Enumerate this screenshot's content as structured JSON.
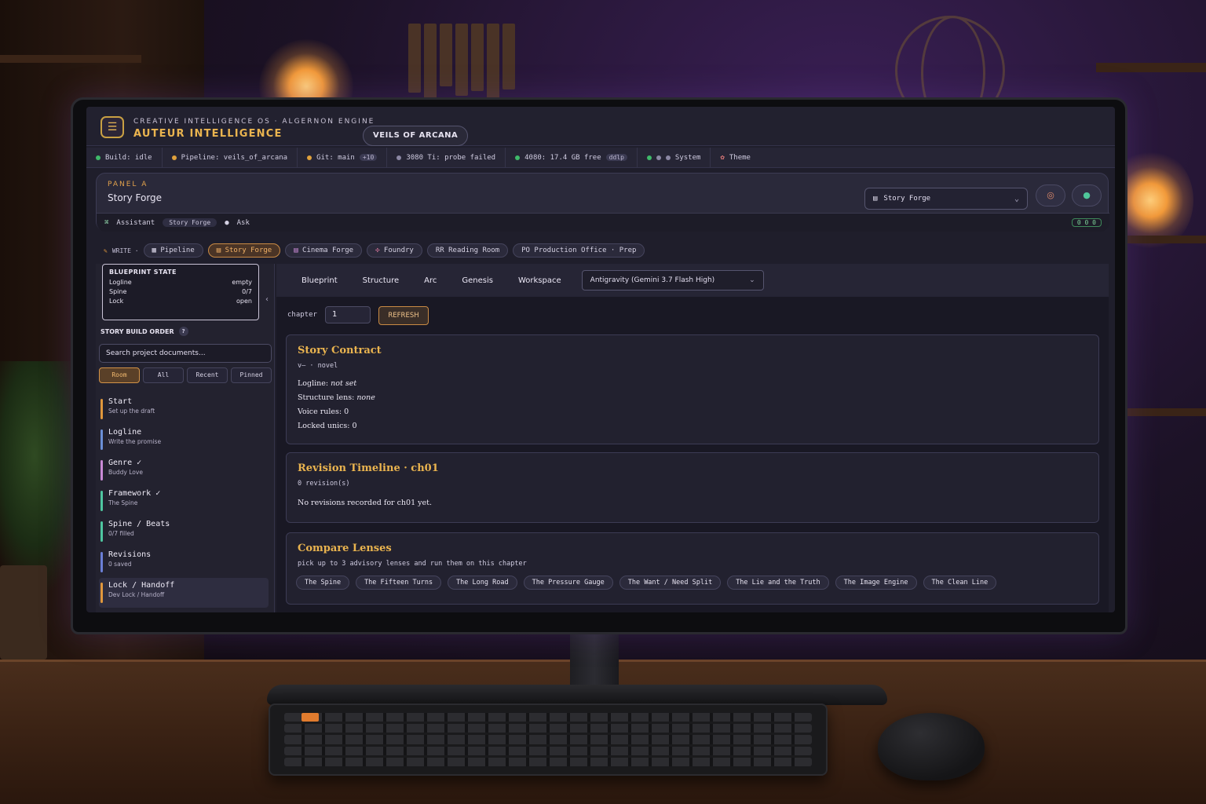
{
  "app": {
    "subtitle": "CREATIVE INTELLIGENCE OS · ALGERNON ENGINE",
    "title": "AUTEUR INTELLIGENCE",
    "project": "VEILS OF ARCANA",
    "logo_icon": "document-icon"
  },
  "status": {
    "build": "Build: idle",
    "pipeline": "Pipeline: veils_of_arcana",
    "git": "Git: main",
    "git_badge": "+10",
    "gpu_3080": "3080 Ti: probe failed",
    "gpu_4080": "4080: 17.4 GB free",
    "gpu_4080_badge": "ddlp",
    "system": "System",
    "theme": "Theme",
    "colors": {
      "build": "#3fb96a",
      "pipeline": "#e0a13c",
      "git": "#e0a13c",
      "gpu_3080": "#8b87a3",
      "gpu_4080": "#3fb96a"
    }
  },
  "panel": {
    "label": "PANEL A",
    "title": "Story Forge",
    "selected": "Story Forge",
    "assistant_label": "Assistant",
    "assistant_chip": "Story Forge",
    "ask_label": "Ask",
    "assistant_badge": "0 0 0"
  },
  "rooms": {
    "write_label": "WRITE ·",
    "tabs": [
      "Pipeline",
      "Story Forge",
      "Cinema Forge",
      "Foundry",
      "RR Reading Room",
      "PO Production Office · Prep"
    ],
    "active": "Story Forge"
  },
  "sidebar": {
    "blueprint_title": "BLUEPRINT STATE",
    "blueprint": [
      {
        "label": "Logline",
        "value": "empty"
      },
      {
        "label": "Spine",
        "value": "0/7"
      },
      {
        "label": "Lock",
        "value": "open"
      }
    ],
    "build_order_label": "STORY BUILD ORDER",
    "build_order_badge": "?",
    "search_placeholder": "Search project documents...",
    "filters": [
      "Room",
      "All",
      "Recent",
      "Pinned"
    ],
    "active_filter": "Room",
    "steps": [
      {
        "name": "Start",
        "sub": "Set up the draft",
        "color": "#e0973c"
      },
      {
        "name": "Logline",
        "sub": "Write the promise",
        "color": "#6b8fd6"
      },
      {
        "name": "Genre ✓",
        "sub": "Buddy Love",
        "color": "#c98ad6"
      },
      {
        "name": "Framework ✓",
        "sub": "The Spine",
        "color": "#4fc6a0"
      },
      {
        "name": "Spine / Beats",
        "sub": "0/7 filled",
        "color": "#4fc6a0"
      },
      {
        "name": "Revisions",
        "sub": "0 saved",
        "color": "#6b7fd6"
      },
      {
        "name": "Lock / Handoff",
        "sub": "Dev Lock / Handoff",
        "color": "#e0973c"
      }
    ]
  },
  "main": {
    "tabs": [
      "Blueprint",
      "Structure",
      "Arc",
      "Genesis",
      "Workspace"
    ],
    "model": "Antigravity (Gemini 3.7 Flash High)",
    "chapter_label": "chapter",
    "chapter_value": "1",
    "refresh_label": "REFRESH",
    "contract": {
      "title": "Story Contract",
      "sub": "v— · novel",
      "logline_label": "Logline:",
      "logline_value": "not set",
      "structure_label": "Structure lens:",
      "structure_value": "none",
      "voice_rules": "Voice rules: 0",
      "locked_unics": "Locked unics: 0"
    },
    "revision": {
      "title": "Revision Timeline · ch01",
      "sub": "0 revision(s)",
      "empty": "No revisions recorded for ch01 yet."
    },
    "compare": {
      "title": "Compare Lenses",
      "sub": "pick up to 3 advisory lenses and run them on this chapter",
      "lenses": [
        "The Spine",
        "The Fifteen Turns",
        "The Long Road",
        "The Pressure Gauge",
        "The Want / Need Split",
        "The Lie and the Truth",
        "The Image Engine",
        "The Clean Line"
      ]
    }
  }
}
